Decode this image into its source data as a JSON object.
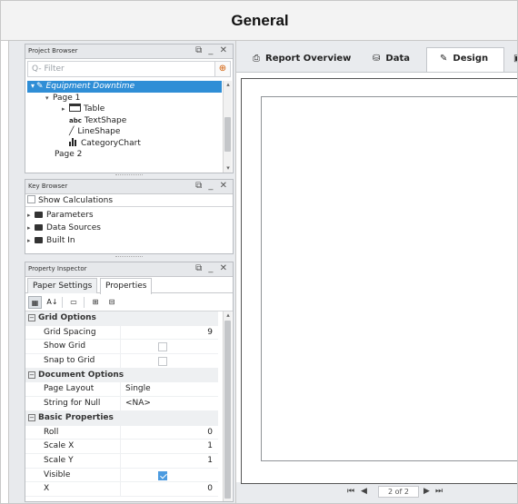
{
  "header": {
    "title": "General"
  },
  "project_browser": {
    "title": "Project Browser",
    "controls": "⧉ _ ✕",
    "filter_placeholder": "Q- Filter",
    "tree": [
      {
        "label": "Equipment Downtime",
        "selected": true
      },
      {
        "label": "Page 1"
      },
      {
        "label": "Table"
      },
      {
        "label": "TextShape"
      },
      {
        "label": "LineShape"
      },
      {
        "label": "CategoryChart"
      },
      {
        "label": "Page 2"
      }
    ]
  },
  "key_browser": {
    "title": "Key Browser",
    "controls": "⧉ _ ✕",
    "show_calculations": "Show Calculations",
    "items": [
      "Parameters",
      "Data Sources",
      "Built In"
    ]
  },
  "property_inspector": {
    "title": "Property Inspector",
    "controls": "⧉ _ ✕",
    "tabs": [
      "Paper Settings",
      "Properties"
    ],
    "active_tab": "Properties",
    "groups": [
      {
        "name": "Grid Options",
        "rows": [
          {
            "name": "Grid Spacing",
            "value": "9",
            "kind": "num"
          },
          {
            "name": "Show Grid",
            "kind": "check",
            "checked": false
          },
          {
            "name": "Snap to Grid",
            "kind": "check",
            "checked": false
          }
        ]
      },
      {
        "name": "Document Options",
        "rows": [
          {
            "name": "Page Layout",
            "value": "Single",
            "kind": "text"
          },
          {
            "name": "String for Null",
            "value": "<NA>",
            "kind": "text"
          }
        ]
      },
      {
        "name": "Basic Properties",
        "rows": [
          {
            "name": "Roll",
            "value": "0",
            "kind": "num"
          },
          {
            "name": "Scale X",
            "value": "1",
            "kind": "num"
          },
          {
            "name": "Scale Y",
            "value": "1",
            "kind": "num"
          },
          {
            "name": "Visible",
            "kind": "check",
            "checked": true
          },
          {
            "name": "X",
            "value": "0",
            "kind": "num"
          }
        ]
      }
    ]
  },
  "report_tabs": {
    "tabs": [
      "Report Overview",
      "Data",
      "Design"
    ],
    "active": "Design"
  },
  "pager": {
    "page_label": "2 of 2"
  },
  "colors": {
    "selection": "#2f8ed6",
    "accent_check": "#4c9be0"
  }
}
